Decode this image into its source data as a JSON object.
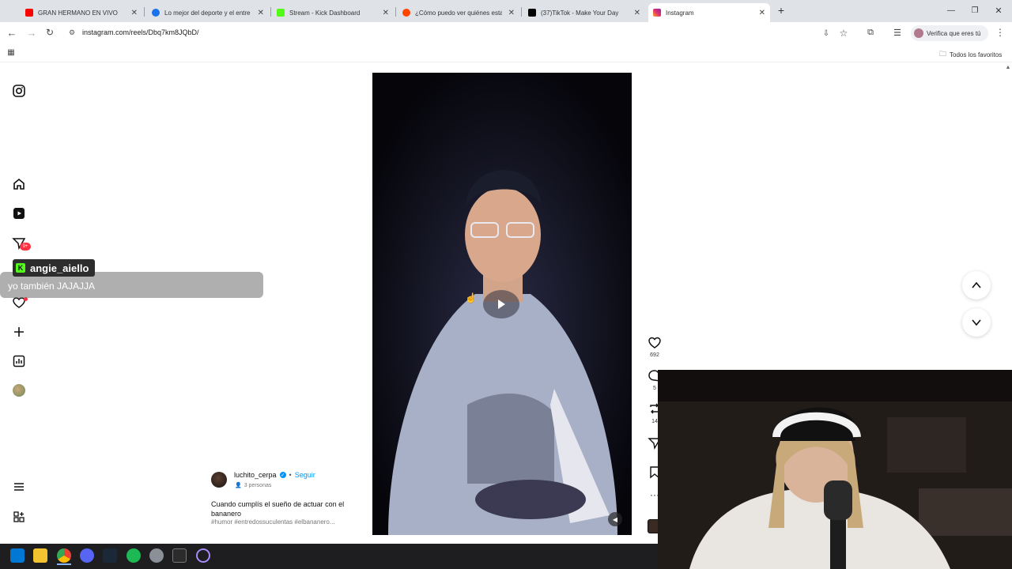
{
  "tabs": [
    {
      "label": "GRAN HERMANO EN VIVO",
      "color": "#ff0000"
    },
    {
      "label": "Lo mejor del deporte y el entre",
      "color": "#1a73e8"
    },
    {
      "label": "Stream - Kick Dashboard",
      "color": "#53fc18"
    },
    {
      "label": "¿Cómo puedo ver quiénes esta",
      "color": "#ff4500"
    },
    {
      "label": "(37)TikTok - Make Your Day",
      "color": "#000000"
    },
    {
      "label": "Instagram",
      "color": "#e1306c"
    }
  ],
  "address_bar": {
    "url": "instagram.com/reels/Dbq7km8JQbD/"
  },
  "profile_chip": {
    "label": "Verifica que eres tú"
  },
  "bookmarks": {
    "all_favorites": "Todos los favoritos"
  },
  "sidebar": {
    "notification_badge": "9+"
  },
  "chat": {
    "username": "angie_aiello",
    "message": "yo también JAJAJJA"
  },
  "post": {
    "author": "luchito_cerpa",
    "separator": "•",
    "follow_label": "Seguir",
    "audience": "3 personas",
    "caption": "Cuando cumplís el sueño de actuar con el bananero",
    "hashtags": "#humor #entredossuculentas #elbananero..."
  },
  "actions": {
    "likes": "692",
    "comments": "5",
    "reposts": "14"
  },
  "colors": {
    "accent": "#0095f6",
    "kick": "#53fc18"
  }
}
